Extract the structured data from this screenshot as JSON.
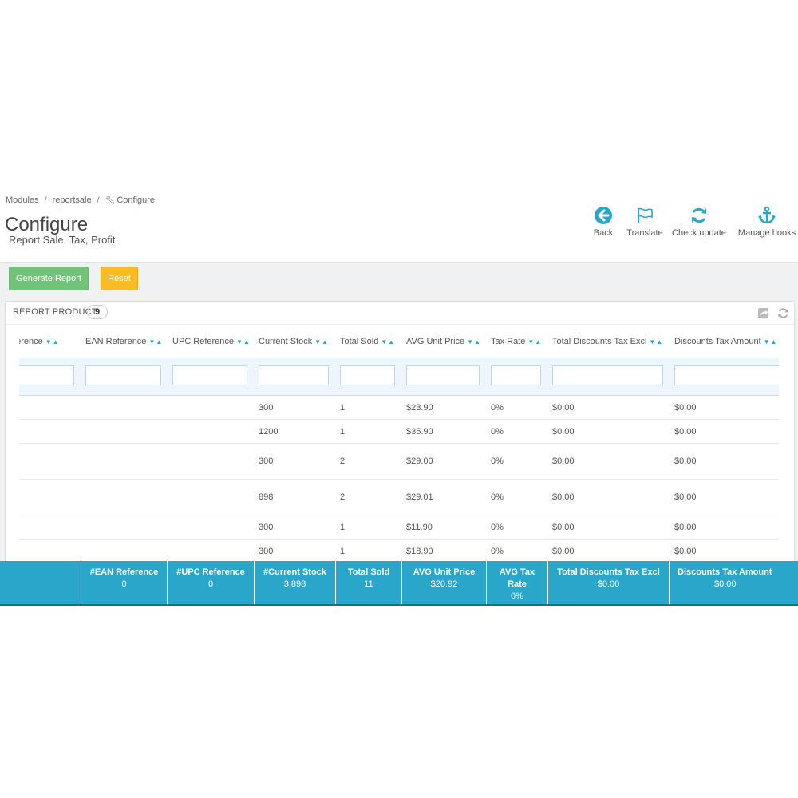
{
  "breadcrumb": {
    "items": [
      "Modules",
      "reportsale",
      "Configure"
    ],
    "separator": "/"
  },
  "page": {
    "title": "Configure",
    "subtitle": "Report Sale, Tax, Profit"
  },
  "toolbar": {
    "back": "Back",
    "translate": "Translate",
    "check_update": "Check update",
    "manage_hooks": "Manage hooks"
  },
  "actions": {
    "generate": "Generate Report",
    "reset": "Reset"
  },
  "panel": {
    "title": "REPORT PRODUCT",
    "count": "9"
  },
  "table": {
    "headers": [
      "Reference",
      "EAN Reference",
      "UPC Reference",
      "Current Stock",
      "Total Sold",
      "AVG Unit Price",
      "Tax Rate",
      "Total Discounts Tax Excl",
      "Discounts Tax Amount"
    ],
    "rows": [
      [
        "300",
        "1",
        "$23.90",
        "0%",
        "$0.00",
        "$0.00"
      ],
      [
        "1200",
        "1",
        "$35.90",
        "0%",
        "$0.00",
        "$0.00"
      ],
      [
        "300",
        "2",
        "$29.00",
        "0%",
        "$0.00",
        "$0.00"
      ],
      [
        "898",
        "2",
        "$29.01",
        "0%",
        "$0.00",
        "$0.00"
      ],
      [
        "300",
        "1",
        "$11.90",
        "0%",
        "$0.00",
        "$0.00"
      ],
      [
        "300",
        "1",
        "$18.90",
        "0%",
        "$0.00",
        "$0.00"
      ]
    ]
  },
  "totals": [
    {
      "label": "#EAN Reference",
      "value": "0"
    },
    {
      "label": "#UPC Reference",
      "value": "0"
    },
    {
      "label": "#Current Stock",
      "value": "3,898"
    },
    {
      "label": "Total Sold",
      "value": "11"
    },
    {
      "label": "AVG Unit Price",
      "value": "$20.92"
    },
    {
      "label": "AVG Tax Rate",
      "value": "0%"
    },
    {
      "label": "Total Discounts Tax Excl",
      "value": "$0.00"
    },
    {
      "label": "Discounts Tax Amount",
      "value": "$0.00"
    }
  ],
  "colors": {
    "accent": "#2ba6cb",
    "success": "#72c279",
    "warning": "#fbbb22"
  }
}
